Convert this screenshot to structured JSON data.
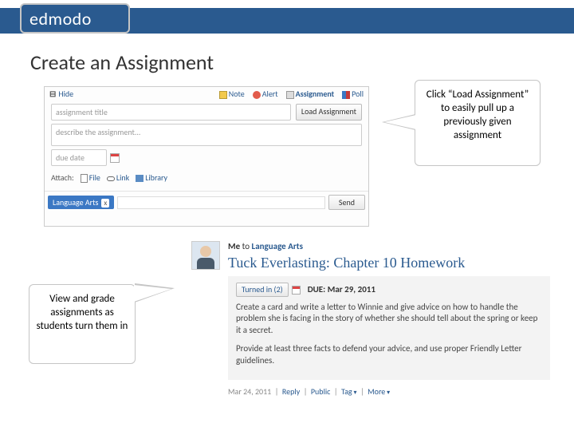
{
  "logo": "edmodo",
  "page_title": "Create an Assignment",
  "form": {
    "hide": "Hide",
    "tabs": {
      "note": "Note",
      "alert": "Alert",
      "assignment": "Assignment",
      "poll": "Poll"
    },
    "title_placeholder": "assignment title",
    "load_btn": "Load Assignment",
    "desc_placeholder": "describe the assignment...",
    "date_placeholder": "due date",
    "attach_label": "Attach:",
    "file": "File",
    "link": "Link",
    "library": "Library",
    "tag": "Language Arts",
    "tag_x": "x",
    "send": "Send"
  },
  "callout1": "Click “Load Assignment” to easily pull up a previously given assignment",
  "callout2": "View and grade assignments as students turn them in",
  "post": {
    "author": "Me",
    "to": "to",
    "group": "Language Arts",
    "title": "Tuck Everlasting: Chapter 10 Homework",
    "turned_in": "Turned in (2)",
    "due_label": "DUE:",
    "due_date": "Mar 29, 2011",
    "para1": "Create a card and write a letter to Winnie and give advice on how to handle the problem she is facing in the story of whether she should tell about the spring or keep it a secret.",
    "para2": "Provide at least three facts to defend your advice, and use proper Friendly Letter guidelines.",
    "meta_date": "Mar 24, 2011",
    "reply": "Reply",
    "public": "Public",
    "tag": "Tag",
    "more": "More"
  }
}
